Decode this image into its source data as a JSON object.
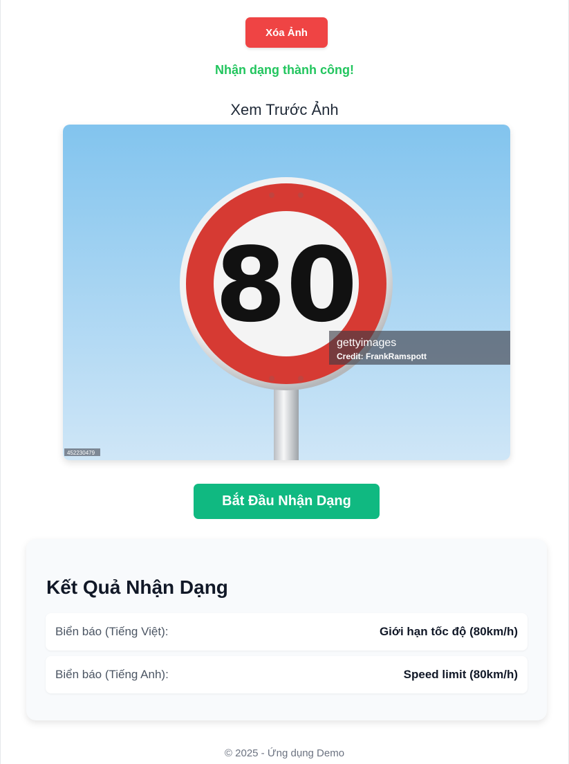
{
  "actions": {
    "delete_label": "Xóa Ảnh",
    "start_label": "Bắt Đầu Nhận Dạng"
  },
  "status": {
    "success_message": "Nhận dạng thành công!",
    "success_color": "#22c55e"
  },
  "preview": {
    "title": "Xem Trước Ảnh",
    "sign_number": "80",
    "watermark_brand": "gettyimages",
    "watermark_credit": "Credit: FrankRamspott",
    "image_id": "452230479"
  },
  "results": {
    "title": "Kết Quả Nhận Dạng",
    "rows": [
      {
        "label": "Biển báo (Tiếng Việt):",
        "value": "Giới hạn tốc độ (80km/h)"
      },
      {
        "label": "Biển báo (Tiếng Anh):",
        "value": "Speed limit (80km/h)"
      }
    ]
  },
  "footer": {
    "text": "© 2025 - Ứng dụng Demo"
  },
  "colors": {
    "delete_button": "#ef4444",
    "start_button": "#10b981",
    "sign_red": "#d63a33"
  },
  "icons": {
    "sign": "speed-limit-sign"
  }
}
